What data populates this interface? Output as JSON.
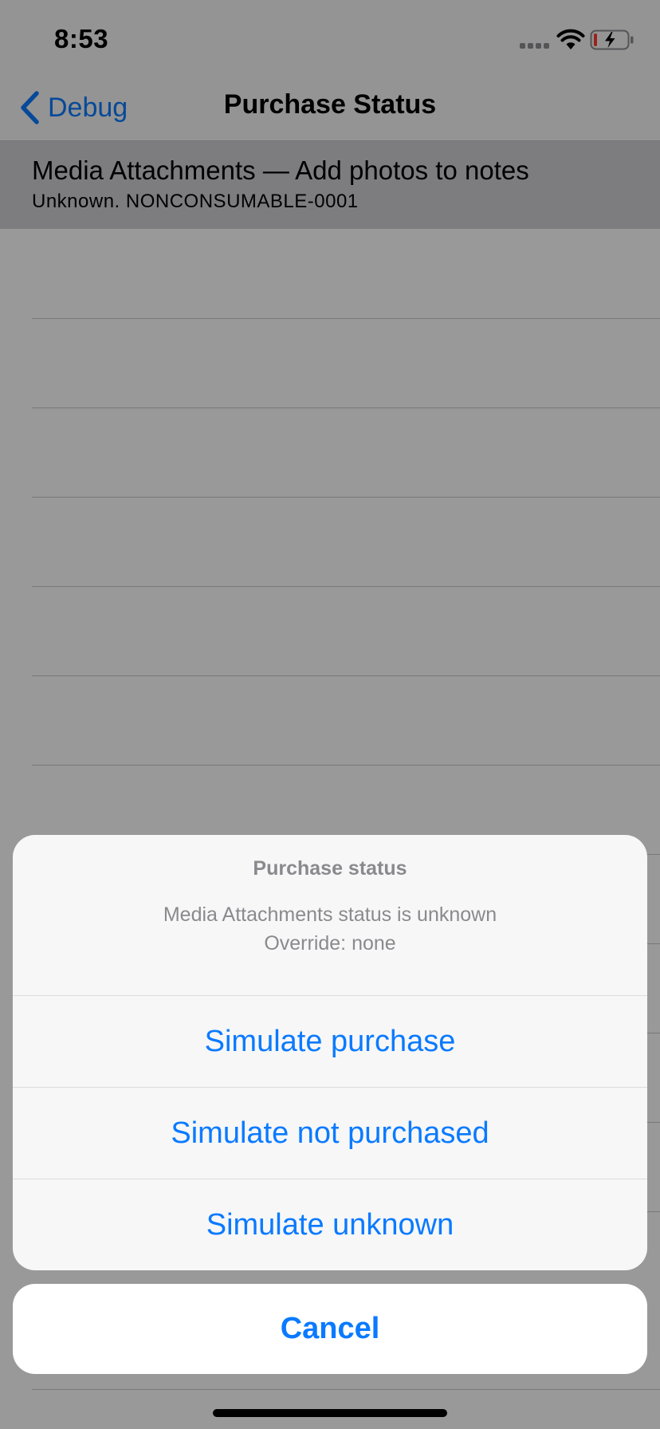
{
  "status_bar": {
    "time": "8:53",
    "signal_icon": "cellular-signal-icon",
    "wifi_icon": "wifi-icon",
    "battery_icon": "battery-charging-icon",
    "battery_level": 0.1
  },
  "nav": {
    "back_label": "Debug",
    "back_icon": "chevron-left-icon",
    "title": "Purchase Status"
  },
  "list": {
    "items": [
      {
        "title": "Media Attachments — Add photos to notes",
        "subtitle": "Unknown. NONCONSUMABLE-0001"
      }
    ]
  },
  "action_sheet": {
    "title": "Purchase status",
    "message_line1": "Media Attachments status is unknown",
    "message_line2": "Override: none",
    "actions": [
      {
        "label": "Simulate purchase"
      },
      {
        "label": "Simulate not purchased"
      },
      {
        "label": "Simulate unknown"
      }
    ],
    "cancel_label": "Cancel"
  },
  "colors": {
    "accent": "#0a7aff",
    "battery_low": "#ff3b30"
  }
}
